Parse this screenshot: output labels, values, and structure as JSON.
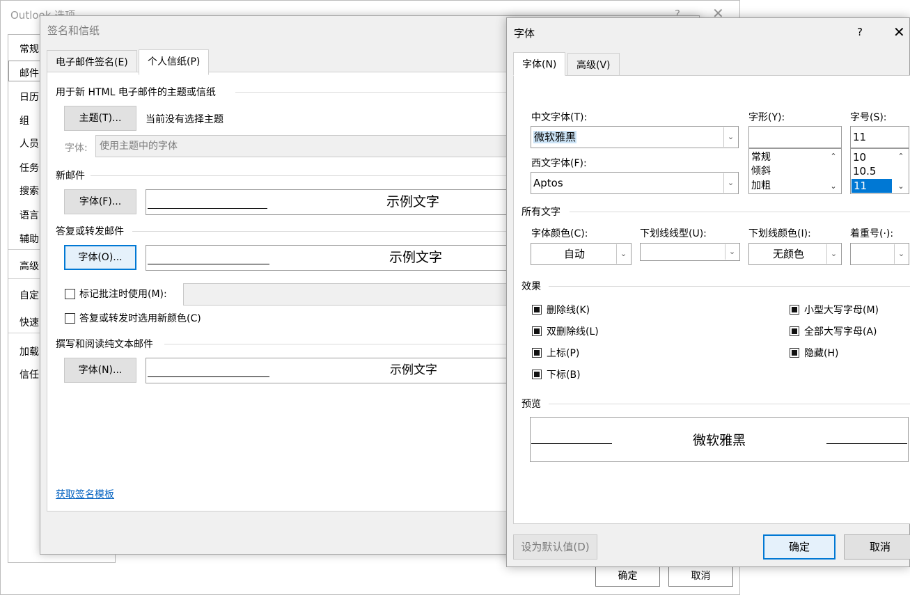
{
  "outlook_options": {
    "title": "Outlook 选项",
    "help": "?",
    "close": "✕",
    "nav": [
      "常规",
      "邮件",
      "日历",
      "组",
      "人员",
      "任务",
      "搜索",
      "语言",
      "辅助",
      "高级",
      "自定",
      "快速",
      "加载",
      "信任"
    ],
    "ok_label": "确定",
    "cancel_label": "取消"
  },
  "signatures": {
    "title": "签名和信纸",
    "tabs": [
      "电子邮件签名(E)",
      "个人信纸(P)"
    ],
    "theme_group": "用于新 HTML 电子邮件的主题或信纸",
    "theme_button": "主题(T)...",
    "theme_status": "当前没有选择主题",
    "font_label": "字体:",
    "font_value": "使用主题中的字体",
    "new_mail_group": "新邮件",
    "reply_group": "答复或转发邮件",
    "plain_group": "撰写和阅读纯文本邮件",
    "font_btn_f": "字体(F)...",
    "font_btn_o": "字体(O)...",
    "font_btn_n": "字体(N)...",
    "sample_text": "示例文字",
    "mark_comments": "标记批注时使用(M):",
    "new_color": "答复或转发时选用新颜色(C)",
    "template_link": "获取签名模板"
  },
  "font_dialog": {
    "title": "字体",
    "help": "?",
    "close": "✕",
    "tabs": [
      "字体(N)",
      "高级(V)"
    ],
    "cn_font_label": "中文字体(T):",
    "cn_font_value": "微软雅黑",
    "west_font_label": "西文字体(F):",
    "west_font_value": "Aptos",
    "style_label": "字形(Y):",
    "style_value": "",
    "style_options": [
      "常规",
      "倾斜",
      "加粗"
    ],
    "size_label": "字号(S):",
    "size_value": "11",
    "size_options": [
      "10",
      "10.5",
      "11"
    ],
    "all_text_group": "所有文字",
    "font_color_label": "字体颜色(C):",
    "font_color_value": "自动",
    "underline_label": "下划线线型(U):",
    "underline_value": "",
    "underline_color_label": "下划线颜色(I):",
    "underline_color_value": "无颜色",
    "emphasis_label": "着重号(·):",
    "emphasis_value": "",
    "effects_group": "效果",
    "effects_left": [
      "删除线(K)",
      "双删除线(L)",
      "上标(P)",
      "下标(B)"
    ],
    "effects_right": [
      "小型大写字母(M)",
      "全部大写字母(A)",
      "隐藏(H)"
    ],
    "preview_group": "预览",
    "preview_text": "微软雅黑",
    "default_button": "设为默认值(D)",
    "ok_button": "确定",
    "cancel_button": "取消"
  },
  "icons": {
    "dropdown": "chevron-down-icon",
    "scroll_up": "chevron-up-icon",
    "scroll_down": "chevron-down-icon",
    "close": "close-icon"
  }
}
